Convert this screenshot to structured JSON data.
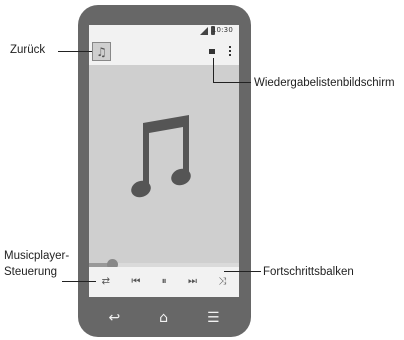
{
  "status_bar": {
    "time": "10:30"
  },
  "app": {
    "back_icon_glyph": "♫",
    "note_icon": "music-note-icon",
    "progress_fraction": 0.15
  },
  "controls": {
    "repeat": "⇄",
    "previous": "⏮",
    "pause": "⏸",
    "next": "⏭",
    "shuffle": "⤨"
  },
  "navbar": {
    "back": "↩",
    "home": "⌂",
    "recents": "☰"
  },
  "annotations": {
    "back": "Zurück",
    "playlist": "Wiedergabelistenbildschirm",
    "controls_line1": "Musicplayer-",
    "controls_line2": "Steuerung",
    "progress": "Fortschrittsbalken"
  },
  "colors": {
    "phone_body": "#676767",
    "screen_bg": "#f2f2f2",
    "art_bg": "#cfcfcf",
    "note": "#555555"
  }
}
